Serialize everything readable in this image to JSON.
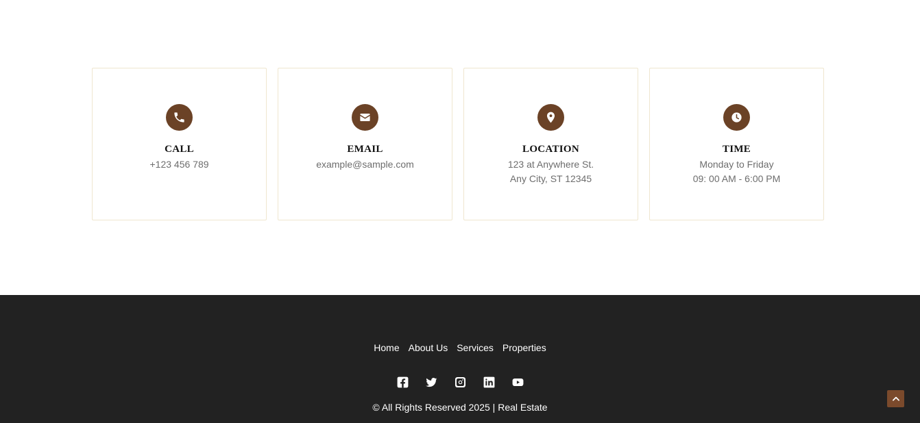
{
  "colors": {
    "accent": "#6b4226",
    "footer_bg": "#222222",
    "card_border": "#efe6cf",
    "muted_text": "#6d6d6d",
    "back_to_top_bg": "#7b4a2c"
  },
  "contact_cards": [
    {
      "icon": "phone-icon",
      "title": "CALL",
      "lines": [
        "+123 456 789",
        ""
      ]
    },
    {
      "icon": "envelope-icon",
      "title": "EMAIL",
      "lines": [
        "example@sample.com",
        ""
      ]
    },
    {
      "icon": "map-pin-icon",
      "title": "LOCATION",
      "lines": [
        "123 at Anywhere St.",
        "Any City, ST 12345"
      ]
    },
    {
      "icon": "clock-icon",
      "title": "TIME",
      "lines": [
        "Monday to Friday",
        "09: 00 AM - 6:00 PM"
      ]
    }
  ],
  "footer": {
    "nav": [
      {
        "label": "Home"
      },
      {
        "label": "About Us"
      },
      {
        "label": "Services"
      },
      {
        "label": "Properties"
      }
    ],
    "social": [
      "facebook-icon",
      "twitter-icon",
      "instagram-icon",
      "linkedin-icon",
      "youtube-icon"
    ],
    "copyright": "© All Rights Reserved 2025 | Real Estate"
  },
  "back_to_top": {
    "icon": "chevron-up-icon"
  }
}
